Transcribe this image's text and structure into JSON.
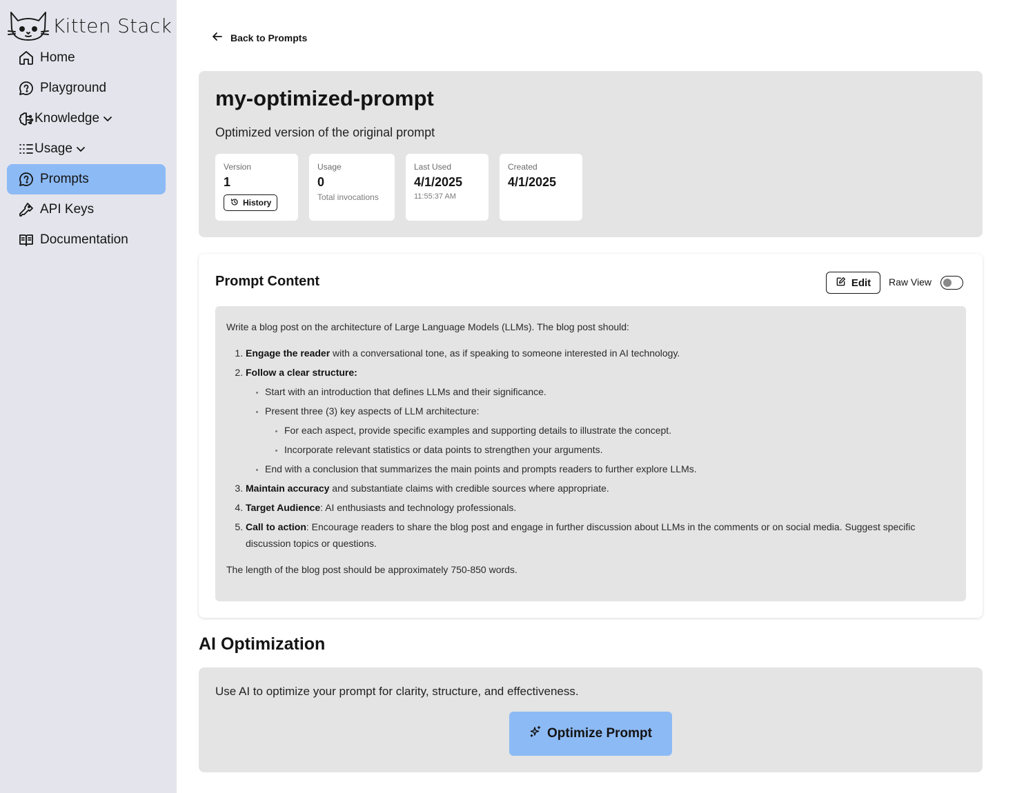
{
  "app": {
    "name": "Kitten Stack"
  },
  "sidebar": {
    "items": [
      {
        "label": "Home",
        "icon": "home-icon"
      },
      {
        "label": "Playground",
        "icon": "chat-icon"
      },
      {
        "label": "Knowledge",
        "icon": "brain-icon",
        "expandable": true
      },
      {
        "label": "Usage",
        "icon": "list-icon",
        "expandable": true
      },
      {
        "label": "Prompts",
        "icon": "chat-icon",
        "active": true
      },
      {
        "label": "API Keys",
        "icon": "key-icon"
      },
      {
        "label": "Documentation",
        "icon": "book-icon"
      }
    ]
  },
  "back_link": "Back to Prompts",
  "prompt": {
    "name": "my-optimized-prompt",
    "description": "Optimized version of the original prompt",
    "stats": {
      "version": {
        "label": "Version",
        "value": "1",
        "button": "History"
      },
      "usage": {
        "label": "Usage",
        "value": "0",
        "sub": "Total invocations"
      },
      "last_used": {
        "label": "Last Used",
        "value": "4/1/2025",
        "sub": "11:55:37 AM"
      },
      "created": {
        "label": "Created",
        "value": "4/1/2025"
      }
    }
  },
  "content_section": {
    "title": "Prompt Content",
    "edit_label": "Edit",
    "raw_view_label": "Raw View",
    "raw_view_on": false,
    "intro": "Write a blog post on the architecture of Large Language Models (LLMs). The blog post should:",
    "items": [
      {
        "bold": "Engage the reader",
        "text": " with a conversational tone, as if speaking to someone interested in AI technology."
      },
      {
        "bold": "Follow a clear structure:",
        "text": ""
      },
      {
        "bold": "Maintain accuracy",
        "text": " and substantiate claims with credible sources where appropriate."
      },
      {
        "bold": "Target Audience",
        "text": ": AI enthusiasts and technology professionals."
      },
      {
        "bold": "Call to action",
        "text": ": Encourage readers to share the blog post and engage in further discussion about LLMs in the comments or on social media. Suggest specific discussion topics or questions."
      }
    ],
    "structure": {
      "intro_point": "Start with an introduction that defines LLMs and their significance.",
      "aspects_point": "Present three (3) key aspects of LLM architecture:",
      "aspect_details": [
        "For each aspect, provide specific examples and supporting details to illustrate the concept.",
        "Incorporate relevant statistics or data points to strengthen your arguments."
      ],
      "conclusion_point": "End with a conclusion that summarizes the main points and prompts readers to further explore LLMs."
    },
    "outro": "The length of the blog post should be approximately 750-850 words."
  },
  "ai_optimization": {
    "title": "AI Optimization",
    "description": "Use AI to optimize your prompt for clarity, structure, and effectiveness.",
    "button_label": "Optimize Prompt"
  },
  "colors": {
    "sidebar_bg": "#e4e4ec",
    "accent": "#8cbaf5",
    "card_bg": "#e4e4e4"
  }
}
